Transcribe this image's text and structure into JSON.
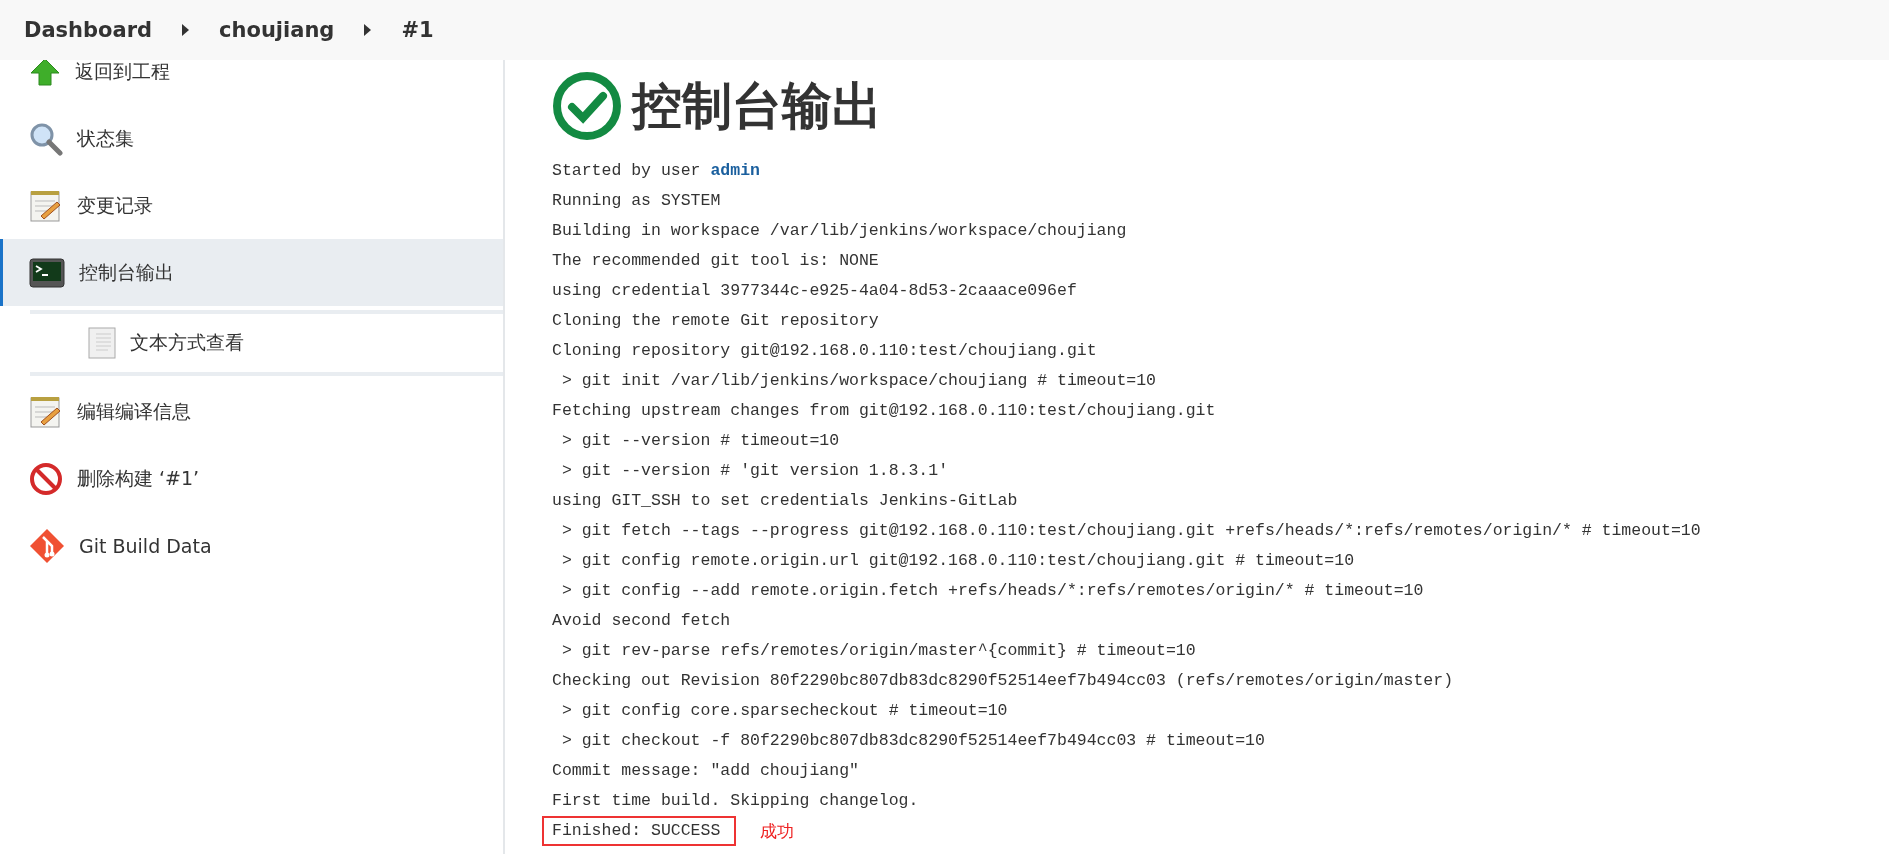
{
  "breadcrumbs": [
    {
      "label": "Dashboard"
    },
    {
      "label": "choujiang"
    },
    {
      "label": "#1"
    }
  ],
  "sidebar": {
    "items": [
      {
        "kind": "up",
        "label": "返回到工程",
        "selected": false
      },
      {
        "kind": "search",
        "label": "状态集",
        "selected": false
      },
      {
        "kind": "notepad",
        "label": "变更记录",
        "selected": false
      },
      {
        "kind": "terminal",
        "label": "控制台输出",
        "selected": true,
        "children": [
          {
            "kind": "document",
            "label": "文本方式查看",
            "selected": false
          }
        ]
      },
      {
        "kind": "notepad",
        "label": "编辑编译信息",
        "selected": false
      },
      {
        "kind": "forbidden",
        "label": "删除构建 ‘#1’",
        "selected": false
      },
      {
        "kind": "git",
        "label": "Git Build Data",
        "selected": false
      }
    ]
  },
  "console": {
    "title": "控制台输出",
    "succeeded": true,
    "lines": [
      {
        "text": "Started by user ",
        "link": "admin"
      },
      {
        "text": "Running as SYSTEM"
      },
      {
        "text": "Building in workspace /var/lib/jenkins/workspace/choujiang"
      },
      {
        "text": "The recommended git tool is: NONE"
      },
      {
        "text": "using credential 3977344c-e925-4a04-8d53-2caaace096ef"
      },
      {
        "text": "Cloning the remote Git repository"
      },
      {
        "text": "Cloning repository git@192.168.0.110:test/choujiang.git"
      },
      {
        "text": " > git init /var/lib/jenkins/workspace/choujiang # timeout=10"
      },
      {
        "text": "Fetching upstream changes from git@192.168.0.110:test/choujiang.git"
      },
      {
        "text": " > git --version # timeout=10"
      },
      {
        "text": " > git --version # 'git version 1.8.3.1'"
      },
      {
        "text": "using GIT_SSH to set credentials Jenkins-GitLab"
      },
      {
        "text": " > git fetch --tags --progress git@192.168.0.110:test/choujiang.git +refs/heads/*:refs/remotes/origin/* # timeout=10"
      },
      {
        "text": " > git config remote.origin.url git@192.168.0.110:test/choujiang.git # timeout=10"
      },
      {
        "text": " > git config --add remote.origin.fetch +refs/heads/*:refs/remotes/origin/* # timeout=10"
      },
      {
        "text": "Avoid second fetch"
      },
      {
        "text": " > git rev-parse refs/remotes/origin/master^{commit} # timeout=10"
      },
      {
        "text": "Checking out Revision 80f2290bc807db83dc8290f52514eef7b494cc03 (refs/remotes/origin/master)"
      },
      {
        "text": " > git config core.sparsecheckout # timeout=10"
      },
      {
        "text": " > git checkout -f 80f2290bc807db83dc8290f52514eef7b494cc03 # timeout=10"
      },
      {
        "text": "Commit message: \"add choujiang\""
      },
      {
        "text": "First time build. Skipping changelog."
      },
      {
        "text": "Finished: SUCCESS",
        "highlighted": true,
        "note": "成功"
      }
    ]
  }
}
